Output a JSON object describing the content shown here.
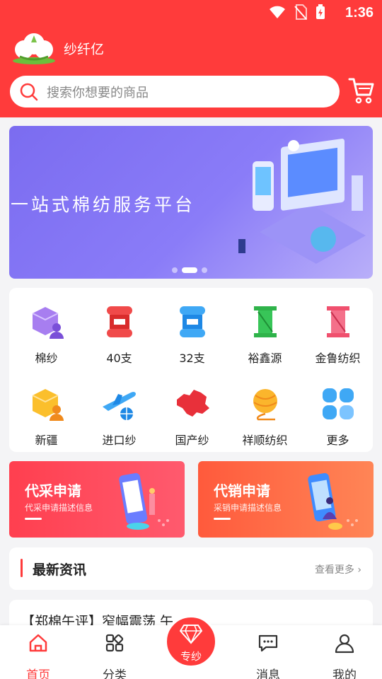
{
  "status": {
    "time": "1:36"
  },
  "brand": {
    "name": "纱纤亿"
  },
  "search": {
    "placeholder": "搜索你想要的商品"
  },
  "banner": {
    "slogan": "一站式棉纺服务平台"
  },
  "categories": [
    {
      "label": "棉纱"
    },
    {
      "label": "40支"
    },
    {
      "label": "32支"
    },
    {
      "label": "裕鑫源"
    },
    {
      "label": "金鲁纺织"
    },
    {
      "label": "新疆"
    },
    {
      "label": "进口纱"
    },
    {
      "label": "国产纱"
    },
    {
      "label": "祥顺纺织"
    },
    {
      "label": "更多"
    }
  ],
  "promos": [
    {
      "title": "代采申请",
      "desc": "代采申请描述信息"
    },
    {
      "title": "代销申请",
      "desc": "采销申请描述信息"
    }
  ],
  "news": {
    "title": "最新资讯",
    "more": "查看更多"
  },
  "article": {
    "text": "【郑棉午评】窄幅震荡 午..."
  },
  "tabs": {
    "home": "首页",
    "category": "分类",
    "center": "专纱",
    "messages": "消息",
    "mine": "我的"
  },
  "colors": {
    "primary": "#ff3b3b",
    "banner": "#7b6cf0"
  }
}
